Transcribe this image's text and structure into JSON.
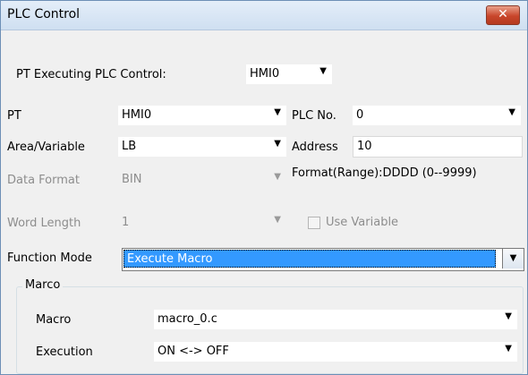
{
  "window": {
    "title": "PLC Control",
    "close_symbol": "✕"
  },
  "pt_exec": {
    "label": "PT Executing PLC Control:",
    "value": "HMI0"
  },
  "pt": {
    "label": "PT",
    "value": "HMI0"
  },
  "plc_no": {
    "label": "PLC No.",
    "value": "0"
  },
  "area": {
    "label": "Area/Variable",
    "value": "LB"
  },
  "address": {
    "label": "Address",
    "value": "10"
  },
  "data_format": {
    "label": "Data Format",
    "value": "BIN"
  },
  "format_range": {
    "text": "Format(Range):DDDD (0--9999)"
  },
  "word_length": {
    "label": "Word Length",
    "value": "1"
  },
  "use_variable": {
    "label": "Use Variable",
    "checked": false
  },
  "function_mode": {
    "label": "Function Mode",
    "value": "Execute Macro"
  },
  "macro_group": {
    "title": "Marco",
    "macro": {
      "label": "Macro",
      "value": "macro_0.c"
    },
    "execution": {
      "label": "Execution",
      "value": "ON <-> OFF"
    }
  },
  "icons": {
    "dropdown": "▼"
  }
}
